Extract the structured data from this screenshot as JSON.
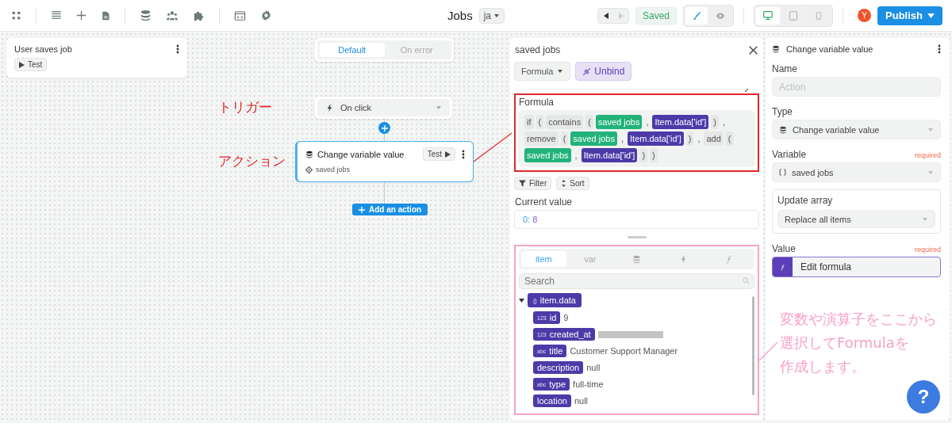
{
  "toolbar": {
    "title": "Jobs",
    "language": "ja",
    "history": [
      {
        "disabled": false
      },
      {
        "disabled": true
      }
    ],
    "save_status": "Saved",
    "mode_tabs": [
      {
        "selected": true
      },
      {
        "selected": false
      }
    ],
    "device_tabs": [
      {
        "selected": true
      },
      {
        "selected": false
      },
      {
        "selected": false
      }
    ],
    "avatar": "Y",
    "publish": "Publish"
  },
  "canvas": {
    "workflow": {
      "title": "User saves job",
      "test": "Test"
    },
    "branch_tabs": [
      {
        "label": "Default",
        "selected": true
      },
      {
        "label": "On error",
        "selected": false
      }
    ],
    "annotations": [
      {
        "text": "トリガー"
      },
      {
        "text": "アクション"
      }
    ],
    "trigger": {
      "label": "On click"
    },
    "action": {
      "title": "Change variable value",
      "test": "Test",
      "variable": "saved jobs",
      "selected": true
    },
    "add_action": "Add an action"
  },
  "formula_panel": {
    "title": "saved jobs",
    "mode": "Formula",
    "unbind": "Unbind",
    "formula_label": "Formula",
    "tokens": [
      {
        "kind": "plain",
        "text": "if"
      },
      {
        "kind": "plain",
        "text": "("
      },
      {
        "kind": "plain",
        "text": "contains"
      },
      {
        "kind": "plain",
        "text": "("
      },
      {
        "kind": "variable",
        "text": "saved jobs"
      },
      {
        "kind": "separator",
        "text": ","
      },
      {
        "kind": "param",
        "text": "Item.data['id']"
      },
      {
        "kind": "plain",
        "text": ")"
      },
      {
        "kind": "separator",
        "text": ","
      },
      {
        "kind": "plain",
        "text": "remove"
      },
      {
        "kind": "plain",
        "text": "("
      },
      {
        "kind": "variable",
        "text": "saved jobs"
      },
      {
        "kind": "separator",
        "text": ","
      },
      {
        "kind": "param",
        "text": "Item.data['id']"
      },
      {
        "kind": "plain",
        "text": ")"
      },
      {
        "kind": "separator",
        "text": ","
      },
      {
        "kind": "plain",
        "text": "add"
      },
      {
        "kind": "plain",
        "text": "("
      },
      {
        "kind": "variable",
        "text": "saved jobs"
      },
      {
        "kind": "separator",
        "text": ","
      },
      {
        "kind": "param",
        "text": "Item.data['id']"
      },
      {
        "kind": "plain",
        "text": ")"
      },
      {
        "kind": "plain",
        "text": ")"
      }
    ],
    "filter": "Filter",
    "sort": "Sort",
    "current_value_label": "Current value",
    "current_value": {
      "index": "0:",
      "value": "8"
    },
    "explorer": {
      "tabs": [
        {
          "label": "item",
          "selected": true
        },
        {
          "label": "var",
          "selected": false
        }
      ],
      "icon_tabs": [
        {
          "selected": false
        },
        {
          "selected": false
        },
        {
          "selected": false
        }
      ],
      "search_placeholder": "Search",
      "tree": {
        "type_label": "{}",
        "name": "item.data",
        "expanded": true,
        "children": [
          {
            "type_label": "123",
            "name": "id",
            "value": "9",
            "redacted": false
          },
          {
            "type_label": "123",
            "name": "created_at",
            "redacted": true
          },
          {
            "type_label": "abc",
            "name": "title",
            "value": "Customer Support Manager",
            "redacted": false
          },
          {
            "name": "description",
            "value": "null",
            "redacted": false
          },
          {
            "type_label": "abc",
            "name": "type",
            "value": "full-time",
            "redacted": false
          },
          {
            "name": "location",
            "value": "null",
            "redacted": false
          }
        ]
      }
    }
  },
  "properties": {
    "title": "Change variable value",
    "name_label": "Name",
    "name_placeholder": "Action",
    "type_label": "Type",
    "type_value": "Change variable value",
    "variable_label": "Variable",
    "variable_required": "required",
    "variable_value": "saved jobs",
    "update_label": "Update array",
    "update_value": "Replace all items",
    "value_label": "Value",
    "value_required": "required",
    "value_button": "Edit formula"
  },
  "note": {
    "lines": [
      "変数や演算子をここから",
      "選択してFormulaを",
      "作成します。"
    ]
  },
  "help": "?"
}
